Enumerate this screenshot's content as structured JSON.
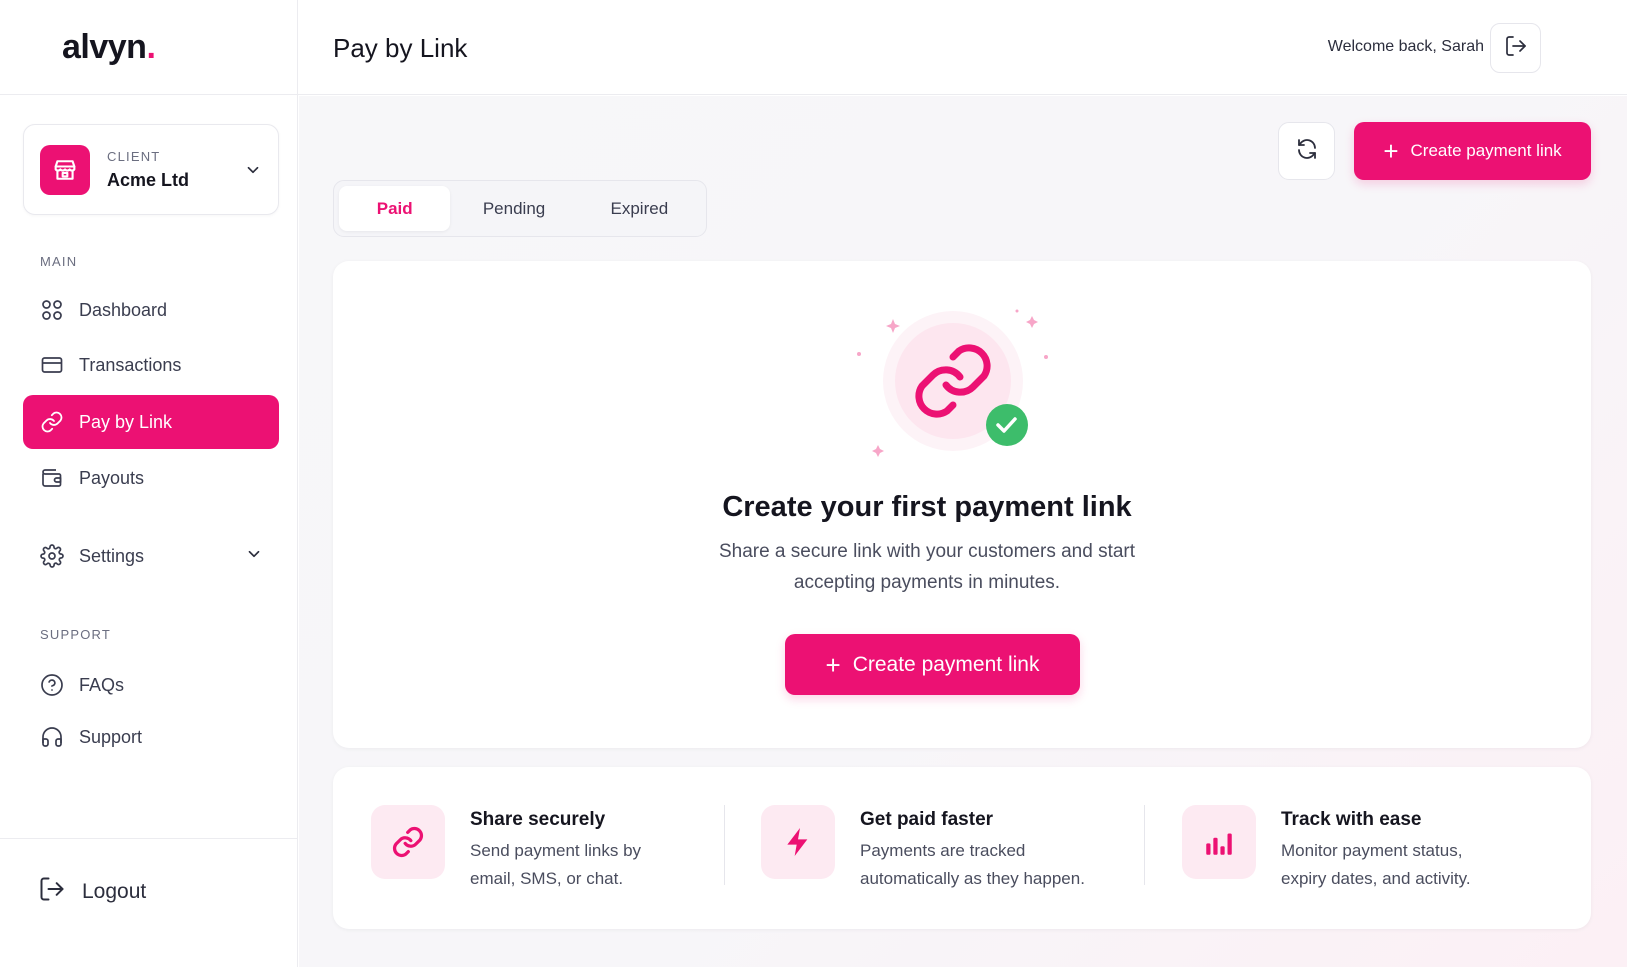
{
  "brand": {
    "name": "alvyn",
    "dot": ".",
    "accent": "#ec1173"
  },
  "client": {
    "caption": "CLIENT",
    "name": "Acme Ltd"
  },
  "nav": {
    "main_label": "MAIN",
    "main_items": [
      {
        "label": "Dashboard",
        "icon": "grid-icon"
      },
      {
        "label": "Transactions",
        "icon": "credit-card-icon"
      },
      {
        "label": "Pay by Link",
        "icon": "link-icon",
        "active": true
      },
      {
        "label": "Payouts",
        "icon": "wallet-icon"
      }
    ],
    "settings": {
      "label": "Settings",
      "icon": "gear-icon"
    },
    "support_label": "SUPPORT",
    "support_items": [
      {
        "label": "FAQs",
        "icon": "question-circle-icon"
      },
      {
        "label": "Support",
        "icon": "headphones-icon"
      }
    ],
    "logout": "Logout"
  },
  "header": {
    "title": "Pay by Link",
    "welcome": "Welcome back, Sarah"
  },
  "toolbar": {
    "create_label": "Create payment link"
  },
  "tabs": [
    {
      "label": "Paid",
      "active": true
    },
    {
      "label": "Pending"
    },
    {
      "label": "Expired"
    }
  ],
  "empty_state": {
    "title": "Create your first payment link",
    "description": "Share a secure link with your customers and start accepting payments in minutes.",
    "button": "Create payment link"
  },
  "features": [
    {
      "title": "Share securely",
      "description": "Send payment links by email, SMS, or chat.",
      "icon": "link-icon"
    },
    {
      "title": "Get paid faster",
      "description": "Payments are tracked automatically as they happen.",
      "icon": "lightning-icon"
    },
    {
      "title": "Track with ease",
      "description": "Monitor payment status, expiry dates, and activity.",
      "icon": "bar-chart-icon"
    }
  ]
}
